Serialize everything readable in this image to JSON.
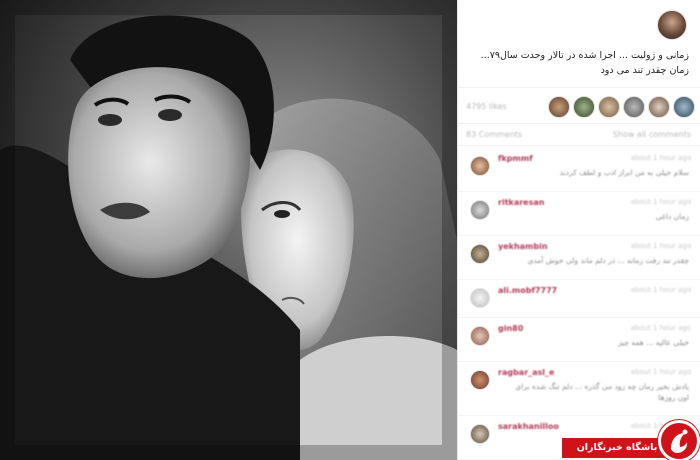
{
  "post": {
    "caption": "زمانی و ژولیت ... اجرا شده در تالار وحدت سال۷۹... زمان چقدر تند می دود",
    "likes_text": "4795 likes",
    "comments_head_left": "83 Comments",
    "comments_head_right": "Show all comments"
  },
  "comments": [
    {
      "user": "fkpmmf",
      "time": "about 1 hour ago",
      "text": "سلام خیلی به من ابراز ادب و لطف کردند"
    },
    {
      "user": "ritkaresan",
      "time": "about 1 hour ago",
      "text": "زمان داغی"
    },
    {
      "user": "yekhambin",
      "time": "about 1 hour ago",
      "text": "چقدر تند رفت زمانه ... در دلم ماند ولی خوش آمدی"
    },
    {
      "user": "ali.mobf7777",
      "time": "about 1 hour ago",
      "text": ""
    },
    {
      "user": "gin80",
      "time": "about 1 hour ago",
      "text": "خیلی عالیه ... همه چیز"
    },
    {
      "user": "ragbar_asl_e",
      "time": "about 1 hour ago",
      "text": "یادش بخیر زمان چه زود می گذره ... دلم تنگ شده برای اون روزها"
    },
    {
      "user": "sarakhanilloo",
      "time": "about 1 hour ago",
      "text": ""
    }
  ],
  "watermark": {
    "label": "باشگاه خبرنگاران"
  }
}
